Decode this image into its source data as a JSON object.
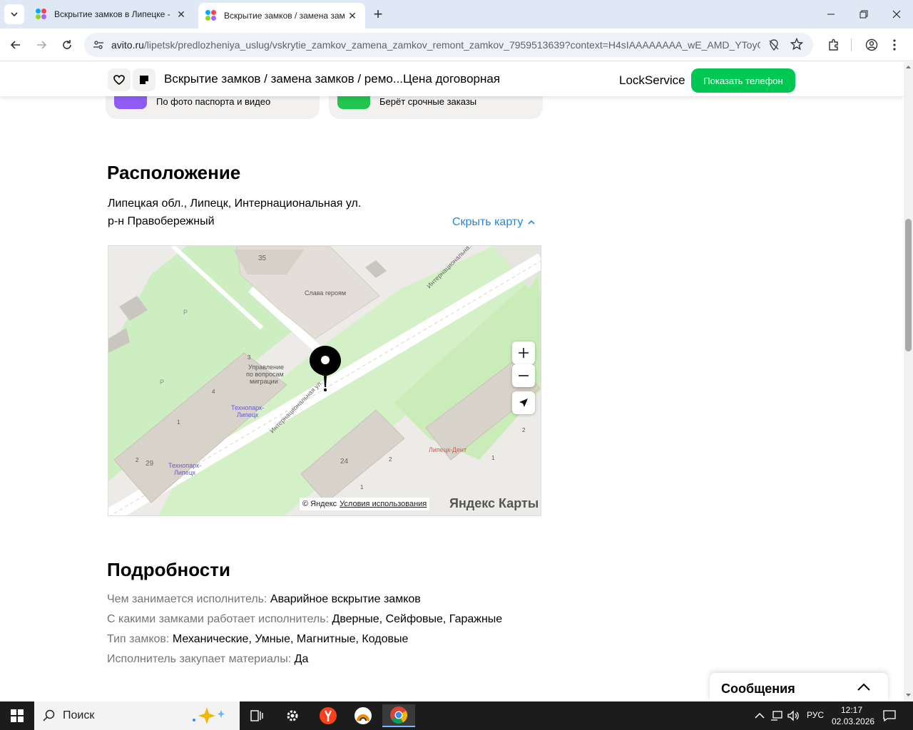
{
  "browser": {
    "tabs": [
      {
        "title": "Вскрытие замков в Липецке - ",
        "active": false
      },
      {
        "title": "Вскрытие замков / замена зам",
        "active": true
      }
    ],
    "address": {
      "host": "avito.ru",
      "path": "/lipetsk/predlozheniya_uslug/vskrytie_zamkov_zamena_zamkov_remont_zamkov_7959513639?context=H4sIAAAAAAAA_wE_AMD_YToyOn..."
    }
  },
  "sticky_header": {
    "title": "Вскрытие замков / замена замков / ремо...",
    "price": "Цена договорная",
    "seller": "LockService",
    "phone_button": "Показать телефон"
  },
  "badges": [
    {
      "text": "По фото паспорта и видео",
      "icon": "passport-check-icon",
      "color": "#8e5cf5"
    },
    {
      "text": "Берёт срочные заказы",
      "icon": "clock-fast-icon",
      "color": "#21c44f"
    }
  ],
  "location": {
    "heading": "Расположение",
    "address_line": "Липецкая обл., Липецк, Интернациональная ул.",
    "district": "р-н Правобережный",
    "hide_map": "Скрыть карту",
    "map": {
      "labels": {
        "monument": "Слава героям",
        "street_top": "Интернациональна...",
        "street_mid": "Интернациональная ул.",
        "migration": "Управление по вопросам миграции",
        "technopark1": "Технопарк-Липецк",
        "technopark2": "Технопарк-Липецк",
        "dent": "Липецк-Дент",
        "n35": "35",
        "n29": "29",
        "n24": "24",
        "e3": "3",
        "e4": "4",
        "e1": "1",
        "e2": "2",
        "e2b": "2",
        "e1b": "1",
        "e2c": "2",
        "e1c": "1",
        "parking1": "Р",
        "parking2": "Р"
      },
      "copyright": "© Яндекс",
      "terms": "Условия использования",
      "brand": "Яндекс Карты"
    }
  },
  "details": {
    "heading": "Подробности",
    "rows": [
      {
        "label": "Чем занимается исполнитель:",
        "value": "Аварийное вскрытие замков"
      },
      {
        "label": "С какими замками работает исполнитель:",
        "value": "Дверные, Сейфовые, Гаражные"
      },
      {
        "label": "Тип замков:",
        "value": "Механические, Умные, Магнитные, Кодовые"
      },
      {
        "label": "Исполнитель закупает материалы:",
        "value": "Да"
      }
    ]
  },
  "messages": {
    "title": "Сообщения"
  },
  "taskbar": {
    "search": "Поиск",
    "lang": "РУС",
    "time": "12:17",
    "date": "02.03.2026"
  }
}
